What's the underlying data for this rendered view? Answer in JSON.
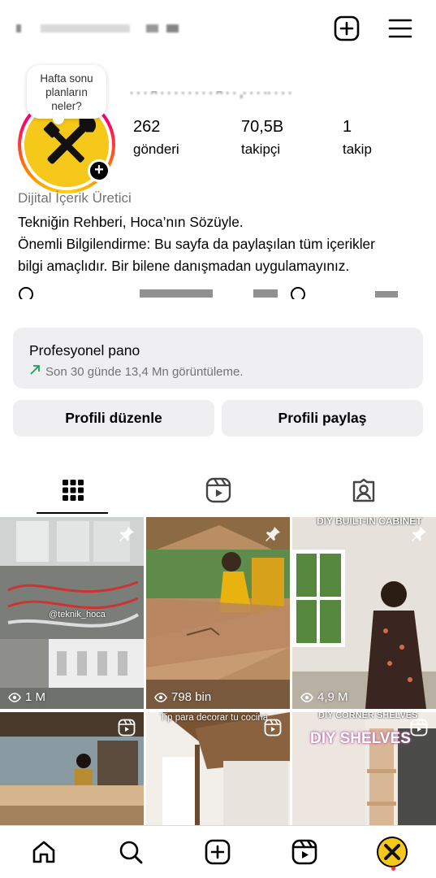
{
  "header": {
    "username": "",
    "icons": [
      "new-post-icon",
      "menu-icon"
    ]
  },
  "profile": {
    "note": "Hafta sonu planların neler?",
    "stats": [
      {
        "value": "262",
        "label": "gönderi"
      },
      {
        "value": "70,5B",
        "label": "takipçi"
      },
      {
        "value": "1",
        "label": "takip"
      }
    ],
    "category": "Dijital İçerik Üretici",
    "bio_lines": [
      "Tekniğin Rehberi, Hoca’nın Sözüyle.",
      "Önemli Bilgilendirme: Bu sayfa da paylaşılan tüm içerikler",
      "bilgi amaçlıdır. Bir bilene danışmadan uygulamayınız."
    ]
  },
  "dashboard": {
    "title": "Profesyonel pano",
    "subtitle": "Son 30 günde 13,4 Mn görüntüleme."
  },
  "actions": {
    "edit_profile": "Profili düzenle",
    "share_profile": "Profili paylaş"
  },
  "tabs": [
    "grid-icon",
    "reels-icon",
    "tagged-icon"
  ],
  "posts": [
    {
      "views": "1 M",
      "pinned": true,
      "caption": "@teknik_hoca"
    },
    {
      "views": "798 bin",
      "pinned": true,
      "caption": ""
    },
    {
      "views": "4,9 M",
      "pinned": true,
      "caption": "DIY BUILT-IN CABINET"
    },
    {
      "views": "",
      "pinned": false,
      "caption": ""
    },
    {
      "views": "",
      "pinned": false,
      "caption": "Tip para decorar tu cocina"
    },
    {
      "views": "",
      "pinned": false,
      "caption": "DIY CORNER SHELVES",
      "big_caption": "DIY SHELVES"
    }
  ],
  "bottom_nav": [
    "home-icon",
    "search-icon",
    "create-icon",
    "reels-icon",
    "profile-avatar"
  ],
  "colors": {
    "accent_green": "#1f9d55",
    "card_bg": "#efeff1",
    "avatar_yellow": "#f6c81a"
  }
}
